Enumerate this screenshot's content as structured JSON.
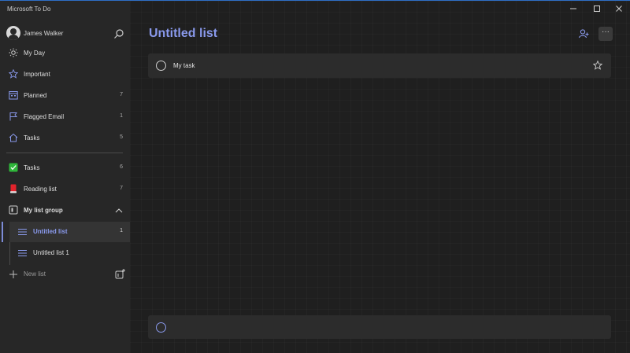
{
  "window": {
    "title": "Microsoft To Do"
  },
  "user": {
    "name": "James Walker"
  },
  "smart_lists": [
    {
      "label": "My Day",
      "count": "",
      "icon": "sun-icon"
    },
    {
      "label": "Important",
      "count": "",
      "icon": "star-icon"
    },
    {
      "label": "Planned",
      "count": "7",
      "icon": "calendar-icon"
    },
    {
      "label": "Flagged Email",
      "count": "1",
      "icon": "flag-icon"
    },
    {
      "label": "Tasks",
      "count": "5",
      "icon": "home-icon"
    }
  ],
  "lists": [
    {
      "label": "Tasks",
      "count": "6",
      "icon": "green-check-icon"
    },
    {
      "label": "Reading list",
      "count": "7",
      "icon": "red-book-icon"
    }
  ],
  "group": {
    "label": "My list group",
    "items": [
      {
        "label": "Untitled list",
        "count": "1",
        "active": true
      },
      {
        "label": "Untitled list 1",
        "count": "",
        "active": false
      }
    ]
  },
  "new_list": {
    "label": "New list"
  },
  "main": {
    "title": "Untitled list",
    "tasks": [
      {
        "title": "My task"
      }
    ],
    "add_task_placeholder": ""
  },
  "colors": {
    "accent": "#8a9aed",
    "sidebar_bg": "#272727",
    "main_bg": "#1f1f1f",
    "row_bg": "#2c2c2c"
  }
}
